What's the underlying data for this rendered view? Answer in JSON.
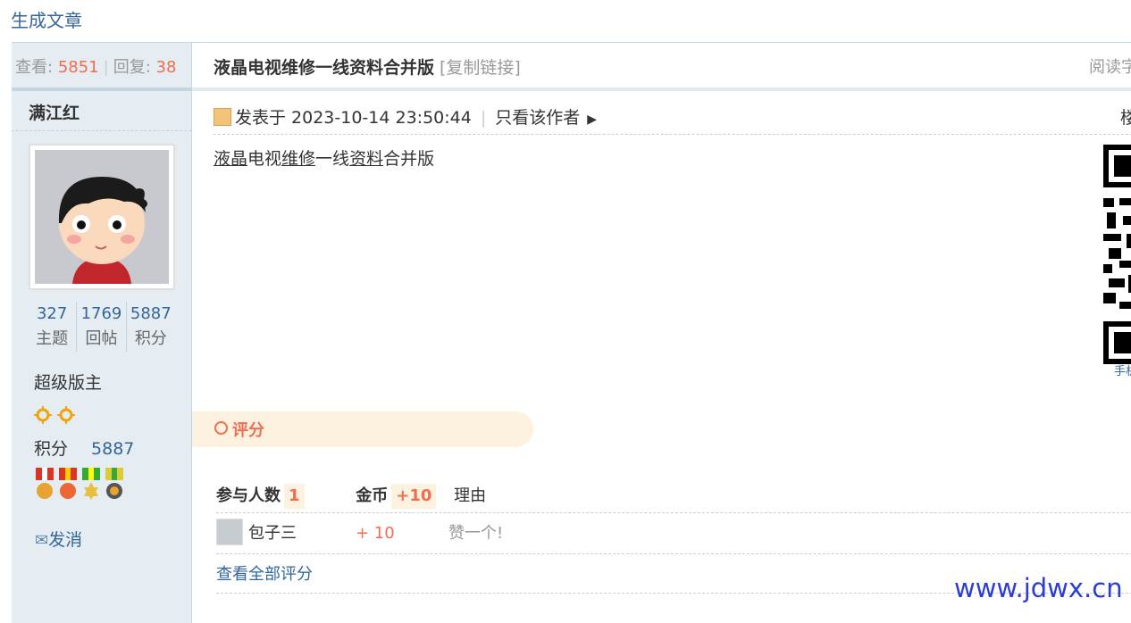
{
  "top_link": "生成文章",
  "sidebar": {
    "views_label": "查看:",
    "views": "5851",
    "replies_label": "回复:",
    "replies": "38",
    "username": "满江红",
    "counts": [
      {
        "value": "327",
        "label": "主题"
      },
      {
        "value": "1769",
        "label": "回帖"
      },
      {
        "value": "5887",
        "label": "积分"
      }
    ],
    "group": "超级版主",
    "jifen_label": "积分",
    "jifen_value": "5887",
    "send_msg": "发消"
  },
  "post": {
    "title": "液晶电视维修一线资料合并版",
    "copy_link": "[复制链接]",
    "read_mode": "阅读字",
    "posted_at": "发表于 2023-10-14 23:50:44",
    "only_author": "只看该作者",
    "floor": "楼",
    "content_parts": [
      "液晶",
      "电视",
      "维修",
      "一线",
      "资料",
      "合并版"
    ],
    "qr_caption": "手机"
  },
  "rating": {
    "header": "评分",
    "participants_label": "参与人数",
    "participants": "1",
    "gold_label": "金币",
    "gold_total": "+10",
    "reason_label": "理由",
    "rows": [
      {
        "user": "包子三",
        "gold": "+ 10",
        "reason": "赞一个!"
      }
    ],
    "view_all": "查看全部评分"
  },
  "watermark": "www.jdwx.cn",
  "colors": {
    "accent": "#f26c4f",
    "link": "#336699",
    "sidebar_bg": "#e5edf2"
  }
}
